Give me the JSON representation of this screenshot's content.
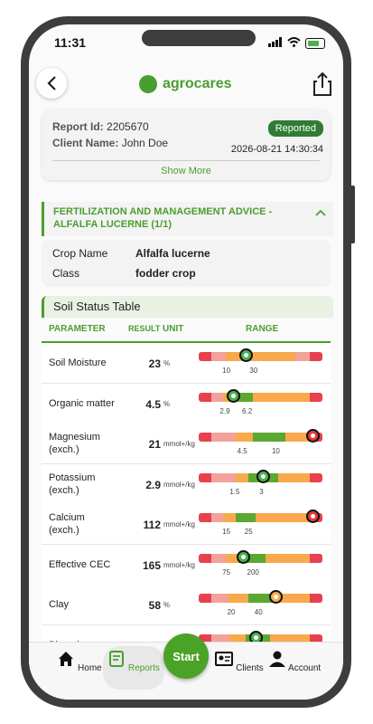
{
  "status_bar": {
    "time": "11:31"
  },
  "header": {
    "brand": "agrocares"
  },
  "report": {
    "id_label": "Report Id:",
    "id_value": "2205670",
    "client_label": "Client Name:",
    "client_value": "John Doe",
    "status": "Reported",
    "date": "2026-08-21 14:30:34",
    "show_more": "Show More"
  },
  "advice": {
    "title": "FERTILIZATION AND MANAGEMENT ADVICE - ALFALFA LUCERNE (1/1)"
  },
  "crop": {
    "name_label": "Crop Name",
    "name_value": "Alfalfa lucerne",
    "class_label": "Class",
    "class_value": "fodder crop"
  },
  "soil_table": {
    "title": "Soil Status Table",
    "headers": {
      "parameter": "PARAMETER",
      "result": "RESULT",
      "unit": "UNIT",
      "range": "RANGE"
    },
    "rows": [
      {
        "name": "Soil Moisture",
        "result": "23",
        "unit": "%",
        "ticks": [
          "10",
          "30"
        ],
        "marker_color": "#4caf50"
      },
      {
        "name": "Organic matter",
        "result": "4.5",
        "unit": "%",
        "ticks": [
          "2.9",
          "6.2"
        ],
        "marker_color": "#4caf50"
      },
      {
        "name": "Magnesium (exch.)",
        "result": "21",
        "unit": "mmol+/kg",
        "ticks": [
          "4.5",
          "10"
        ],
        "marker_color": "#e53935"
      },
      {
        "name": "Potassium (exch.)",
        "result": "2.9",
        "unit": "mmol+/kg",
        "ticks": [
          "1.5",
          "3"
        ],
        "marker_color": "#4caf50"
      },
      {
        "name": "Calcium (exch.)",
        "result": "112",
        "unit": "mmol+/kg",
        "ticks": [
          "15",
          "25"
        ],
        "marker_color": "#e53935"
      },
      {
        "name": "Effective CEC",
        "result": "165",
        "unit": "mmol+/kg",
        "ticks": [
          "75",
          "200"
        ],
        "marker_color": "#4caf50"
      },
      {
        "name": "Clay",
        "result": "58",
        "unit": "%",
        "ticks": [
          "20",
          "40"
        ],
        "marker_color": "#f9a94b"
      },
      {
        "name": "Phosphorus",
        "result": "",
        "unit": "",
        "ticks": [],
        "marker_color": "#4caf50"
      }
    ]
  },
  "nav": {
    "home": "Home",
    "reports": "Reports",
    "start": "Start",
    "clients": "Clients",
    "account": "Account"
  }
}
